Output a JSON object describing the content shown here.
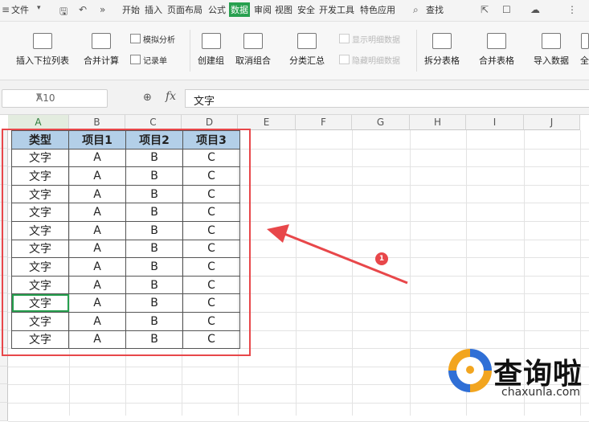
{
  "menubar": {
    "file_label": "文件",
    "tabs": [
      "开始",
      "插入",
      "页面布局",
      "公式",
      "数据",
      "审阅",
      "视图",
      "安全",
      "开发工具",
      "特色应用"
    ],
    "active_tab": "数据",
    "search_label": "查找"
  },
  "ribbon": {
    "insert_dropdown": "插入下拉列表",
    "merge_calc": "合并计算",
    "what_if": "模拟分析",
    "record_sheet": "记录单",
    "create_group": "创建组",
    "ungroup": "取消组合",
    "subtotal": "分类汇总",
    "show_detail": "显示明细数据",
    "hide_detail": "隐藏明细数据",
    "split_table": "拆分表格",
    "merge_table": "合并表格",
    "import_data": "导入数据",
    "cut_label": "全"
  },
  "formula_bar": {
    "cell_ref": "A10",
    "fx": "fx",
    "content": "文字"
  },
  "columns": [
    "A",
    "B",
    "C",
    "D",
    "E",
    "F",
    "G",
    "H",
    "I",
    "J"
  ],
  "table": {
    "headers": [
      "类型",
      "项目1",
      "项目2",
      "项目3"
    ],
    "rows": [
      [
        "文字",
        "A",
        "B",
        "C"
      ],
      [
        "文字",
        "A",
        "B",
        "C"
      ],
      [
        "文字",
        "A",
        "B",
        "C"
      ],
      [
        "文字",
        "A",
        "B",
        "C"
      ],
      [
        "文字",
        "A",
        "B",
        "C"
      ],
      [
        "文字",
        "A",
        "B",
        "C"
      ],
      [
        "文字",
        "A",
        "B",
        "C"
      ],
      [
        "文字",
        "A",
        "B",
        "C"
      ],
      [
        "文字",
        "A",
        "B",
        "C"
      ],
      [
        "文字",
        "A",
        "B",
        "C"
      ],
      [
        "文字",
        "A",
        "B",
        "C"
      ]
    ],
    "active_row": 8,
    "header_color": "#b3cfe8"
  },
  "annotation": {
    "badge": "1",
    "color": "#e8474a"
  },
  "watermark": {
    "cn": "查询啦",
    "en": "chaxunla.com"
  },
  "colors": {
    "accent": "#27a04f"
  }
}
